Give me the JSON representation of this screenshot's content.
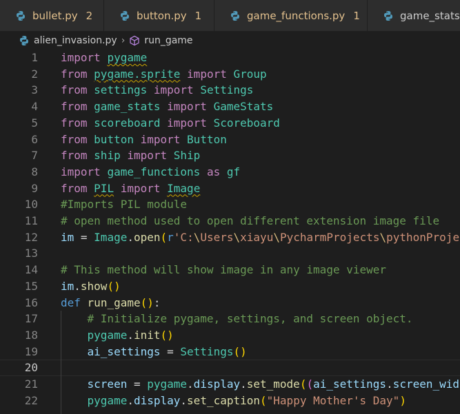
{
  "tabs": [
    {
      "name": "bullet.py",
      "count": "2"
    },
    {
      "name": "button.py",
      "count": "1"
    },
    {
      "name": "game_functions.py",
      "count": "1"
    },
    {
      "name": "game_stats.py",
      "count": ""
    }
  ],
  "breadcrumb": {
    "file": "alien_invasion.py",
    "separator": "›",
    "symbol": "run_game"
  },
  "active_line": 20,
  "lines": [
    {
      "n": "1",
      "tokens": [
        [
          "kw-imp",
          "import"
        ],
        [
          "txt",
          " "
        ],
        [
          "mod squig",
          "pygame"
        ]
      ]
    },
    {
      "n": "2",
      "tokens": [
        [
          "kw-imp",
          "from"
        ],
        [
          "txt",
          " "
        ],
        [
          "mod squig",
          "pygame.sprite"
        ],
        [
          "txt",
          " "
        ],
        [
          "kw-imp",
          "import"
        ],
        [
          "txt",
          " "
        ],
        [
          "cls",
          "Group"
        ]
      ]
    },
    {
      "n": "3",
      "tokens": [
        [
          "kw-imp",
          "from"
        ],
        [
          "txt",
          " "
        ],
        [
          "mod",
          "settings"
        ],
        [
          "txt",
          " "
        ],
        [
          "kw-imp",
          "import"
        ],
        [
          "txt",
          " "
        ],
        [
          "cls",
          "Settings"
        ]
      ]
    },
    {
      "n": "4",
      "tokens": [
        [
          "kw-imp",
          "from"
        ],
        [
          "txt",
          " "
        ],
        [
          "mod",
          "game_stats"
        ],
        [
          "txt",
          " "
        ],
        [
          "kw-imp",
          "import"
        ],
        [
          "txt",
          " "
        ],
        [
          "cls",
          "GameStats"
        ]
      ]
    },
    {
      "n": "5",
      "tokens": [
        [
          "kw-imp",
          "from"
        ],
        [
          "txt",
          " "
        ],
        [
          "mod",
          "scoreboard"
        ],
        [
          "txt",
          " "
        ],
        [
          "kw-imp",
          "import"
        ],
        [
          "txt",
          " "
        ],
        [
          "cls",
          "Scoreboard"
        ]
      ]
    },
    {
      "n": "6",
      "tokens": [
        [
          "kw-imp",
          "from"
        ],
        [
          "txt",
          " "
        ],
        [
          "mod",
          "button"
        ],
        [
          "txt",
          " "
        ],
        [
          "kw-imp",
          "import"
        ],
        [
          "txt",
          " "
        ],
        [
          "cls",
          "Button"
        ]
      ]
    },
    {
      "n": "7",
      "tokens": [
        [
          "kw-imp",
          "from"
        ],
        [
          "txt",
          " "
        ],
        [
          "mod",
          "ship"
        ],
        [
          "txt",
          " "
        ],
        [
          "kw-imp",
          "import"
        ],
        [
          "txt",
          " "
        ],
        [
          "cls",
          "Ship"
        ]
      ]
    },
    {
      "n": "8",
      "tokens": [
        [
          "kw-imp",
          "import"
        ],
        [
          "txt",
          " "
        ],
        [
          "mod",
          "game_functions"
        ],
        [
          "txt",
          " "
        ],
        [
          "kw-imp",
          "as"
        ],
        [
          "txt",
          " "
        ],
        [
          "mod",
          "gf"
        ]
      ]
    },
    {
      "n": "9",
      "tokens": [
        [
          "kw-imp",
          "from"
        ],
        [
          "txt",
          " "
        ],
        [
          "mod squig",
          "PIL"
        ],
        [
          "txt",
          " "
        ],
        [
          "kw-imp",
          "import"
        ],
        [
          "txt",
          " "
        ],
        [
          "cls squig",
          "Image"
        ]
      ]
    },
    {
      "n": "10",
      "tokens": [
        [
          "cmt",
          "#Imports PIL module"
        ]
      ]
    },
    {
      "n": "11",
      "tokens": [
        [
          "cmt",
          "# open method used to open different extension image file"
        ]
      ]
    },
    {
      "n": "12",
      "tokens": [
        [
          "var",
          "im"
        ],
        [
          "txt",
          " = "
        ],
        [
          "cls",
          "Image"
        ],
        [
          "txt",
          "."
        ],
        [
          "fn",
          "open"
        ],
        [
          "p1",
          "("
        ],
        [
          "kwr",
          "r"
        ],
        [
          "str",
          "'C:"
        ],
        [
          "esc",
          "\\"
        ],
        [
          "str",
          "Users"
        ],
        [
          "esc",
          "\\"
        ],
        [
          "str",
          "xiayu"
        ],
        [
          "esc",
          "\\"
        ],
        [
          "str",
          "PycharmProjects"
        ],
        [
          "esc",
          "\\"
        ],
        [
          "str",
          "pythonProject"
        ]
      ]
    },
    {
      "n": "13",
      "tokens": []
    },
    {
      "n": "14",
      "tokens": [
        [
          "cmt",
          "# This method will show image in any image viewer"
        ]
      ]
    },
    {
      "n": "15",
      "tokens": [
        [
          "var",
          "im"
        ],
        [
          "txt",
          "."
        ],
        [
          "fn",
          "show"
        ],
        [
          "p1",
          "()"
        ]
      ]
    },
    {
      "n": "16",
      "tokens": [
        [
          "kw-def",
          "def"
        ],
        [
          "txt",
          " "
        ],
        [
          "fn",
          "run_game"
        ],
        [
          "p1",
          "()"
        ],
        [
          "txt",
          ":"
        ]
      ]
    },
    {
      "n": "17",
      "tokens": [
        [
          "txt",
          "    "
        ],
        [
          "cmt",
          "# Initialize pygame, settings, and screen object."
        ]
      ]
    },
    {
      "n": "18",
      "tokens": [
        [
          "txt",
          "    "
        ],
        [
          "mod",
          "pygame"
        ],
        [
          "txt",
          "."
        ],
        [
          "fn",
          "init"
        ],
        [
          "p1",
          "()"
        ]
      ]
    },
    {
      "n": "19",
      "tokens": [
        [
          "txt",
          "    "
        ],
        [
          "var",
          "ai_settings"
        ],
        [
          "txt",
          " = "
        ],
        [
          "cls",
          "Settings"
        ],
        [
          "p1",
          "()"
        ]
      ]
    },
    {
      "n": "20",
      "tokens": []
    },
    {
      "n": "21",
      "tokens": [
        [
          "txt",
          "    "
        ],
        [
          "var",
          "screen"
        ],
        [
          "txt",
          " = "
        ],
        [
          "mod",
          "pygame"
        ],
        [
          "txt",
          "."
        ],
        [
          "var",
          "display"
        ],
        [
          "txt",
          "."
        ],
        [
          "fn",
          "set_mode"
        ],
        [
          "p1",
          "("
        ],
        [
          "p2",
          "("
        ],
        [
          "var",
          "ai_settings"
        ],
        [
          "txt",
          "."
        ],
        [
          "var",
          "screen_width"
        ]
      ]
    },
    {
      "n": "22",
      "tokens": [
        [
          "txt",
          "    "
        ],
        [
          "mod",
          "pygame"
        ],
        [
          "txt",
          "."
        ],
        [
          "var",
          "display"
        ],
        [
          "txt",
          "."
        ],
        [
          "fn",
          "set_caption"
        ],
        [
          "p1",
          "("
        ],
        [
          "str",
          "\"Happy Mother's Day\""
        ],
        [
          "p1",
          ")"
        ]
      ]
    }
  ],
  "colors": {
    "editor_bg": "#1e1e1e",
    "tab_bg": "#2d2d2d",
    "warning": "#e2c08d"
  },
  "icons": [
    "python-file-icon",
    "symbol-method-icon",
    "chevron-right-icon"
  ]
}
